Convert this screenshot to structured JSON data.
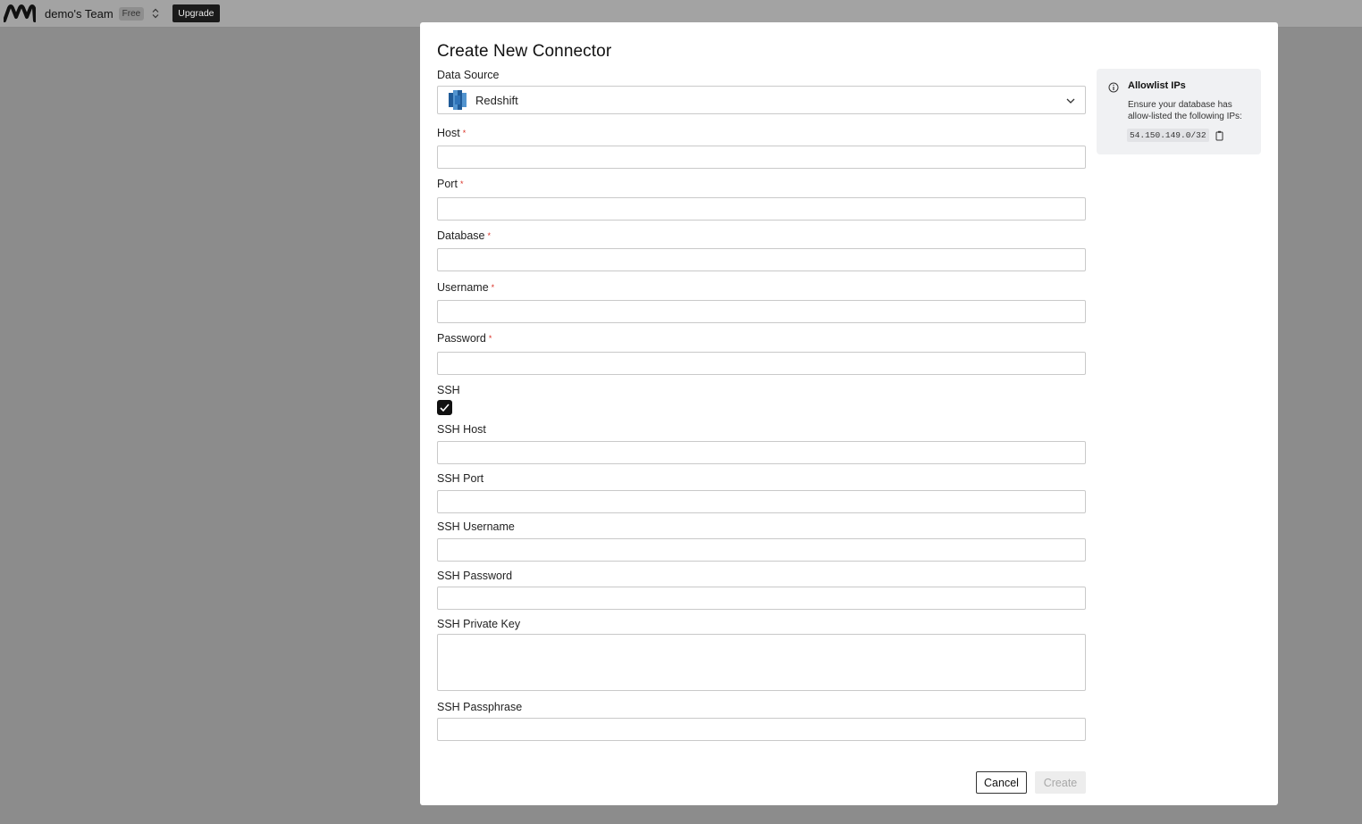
{
  "topbar": {
    "team_name": "demo's Team",
    "plan": "Free",
    "upgrade_label": "Upgrade"
  },
  "modal": {
    "title": "Create New Connector",
    "data_source": {
      "label": "Data Source",
      "selected": "Redshift",
      "icon": "redshift-icon"
    },
    "fields": {
      "host": {
        "label": "Host",
        "value": "",
        "required": true
      },
      "port": {
        "label": "Port",
        "value": "",
        "required": true
      },
      "database": {
        "label": "Database",
        "value": "",
        "required": true
      },
      "username": {
        "label": "Username",
        "value": "",
        "required": true
      },
      "password": {
        "label": "Password",
        "value": "",
        "required": true
      },
      "ssh": {
        "label": "SSH",
        "checked": true
      },
      "ssh_host": {
        "label": "SSH Host",
        "value": ""
      },
      "ssh_port": {
        "label": "SSH Port",
        "value": ""
      },
      "ssh_username": {
        "label": "SSH Username",
        "value": ""
      },
      "ssh_password": {
        "label": "SSH Password",
        "value": ""
      },
      "ssh_private_key": {
        "label": "SSH Private Key",
        "value": ""
      },
      "ssh_passphrase": {
        "label": "SSH Passphrase",
        "value": ""
      }
    },
    "required_mark": "*",
    "cancel_label": "Cancel",
    "create_label": "Create"
  },
  "allowlist": {
    "title": "Allowlist IPs",
    "description": "Ensure your database has allow-listed the following IPs:",
    "ip": "54.150.149.0/32"
  },
  "colors": {
    "overlay": "#8c8c8c",
    "required": "#d93025",
    "redshift_dark": "#205b98",
    "redshift_light": "#5294cf"
  }
}
